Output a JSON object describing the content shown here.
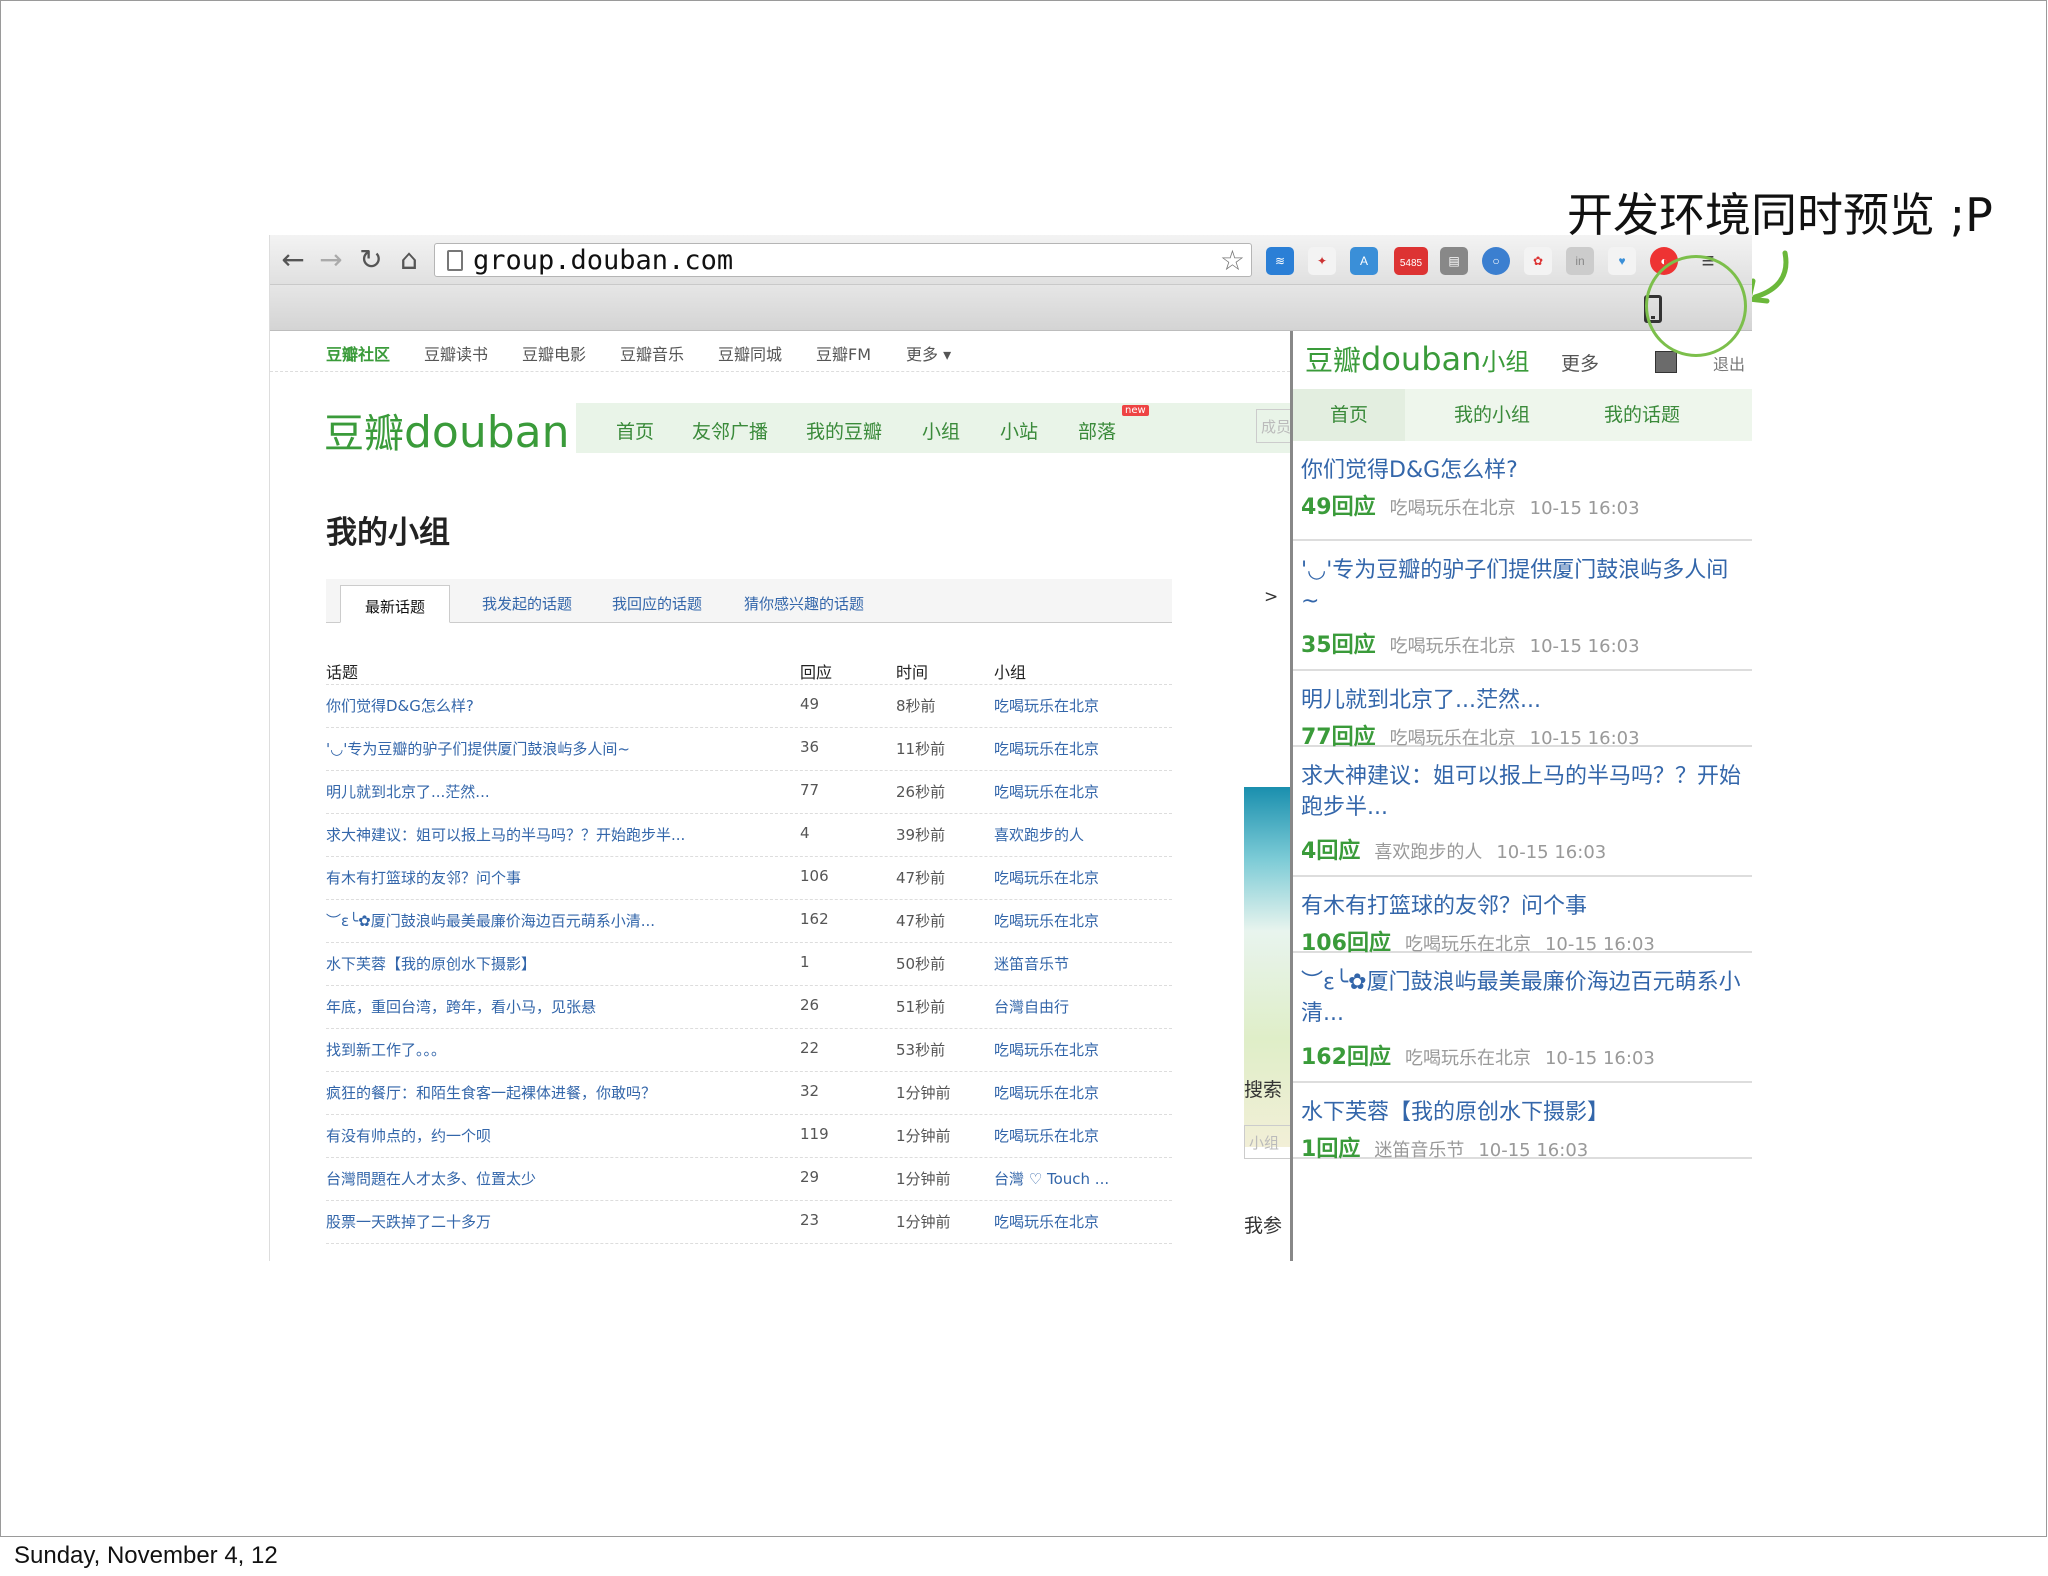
{
  "caption": "开发环境同时预览 ;P",
  "footer": "Sunday, November 4, 12",
  "browser": {
    "url": "group.douban.com",
    "ext_badge": "5485"
  },
  "page": {
    "topnav": [
      "豆瓣社区",
      "豆瓣读书",
      "豆瓣电影",
      "豆瓣音乐",
      "豆瓣同城",
      "豆瓣FM",
      "更多 ▾"
    ],
    "logo_cn": "豆瓣",
    "logo_en": "douban",
    "mainnav": [
      "首页",
      "友邻广播",
      "我的豆瓣",
      "小组",
      "小站",
      "部落"
    ],
    "new_badge": "new",
    "search_placeholder": "成员",
    "heading": "我的小组",
    "tabs": [
      "最新话题",
      "我发起的话题",
      "我回应的话题",
      "猜你感兴趣的话题"
    ],
    "columns": [
      "话题",
      "回应",
      "时间",
      "小组"
    ],
    "rows": [
      {
        "title": "你们觉得D&G怎么样?",
        "reply": "49",
        "time": "8秒前",
        "group": "吃喝玩乐在北京"
      },
      {
        "title": "'◡'专为豆瓣的驴子们提供厦门鼓浪屿多人间~",
        "reply": "36",
        "time": "11秒前",
        "group": "吃喝玩乐在北京"
      },
      {
        "title": "明儿就到北京了...茫然...",
        "reply": "77",
        "time": "26秒前",
        "group": "吃喝玩乐在北京"
      },
      {
        "title": "求大神建议：姐可以报上马的半马吗？？开始跑步半...",
        "reply": "4",
        "time": "39秒前",
        "group": "喜欢跑步的人"
      },
      {
        "title": "有木有打篮球的友邻？问个事",
        "reply": "106",
        "time": "47秒前",
        "group": "吃喝玩乐在北京"
      },
      {
        "title": "︶ε╰✿厦门鼓浪屿最美最廉价海边百元萌系小清...",
        "reply": "162",
        "time": "47秒前",
        "group": "吃喝玩乐在北京"
      },
      {
        "title": "水下芙蓉【我的原创水下摄影】",
        "reply": "1",
        "time": "50秒前",
        "group": "迷笛音乐节"
      },
      {
        "title": "年底，重回台湾，跨年，看小马，见张悬",
        "reply": "26",
        "time": "51秒前",
        "group": "台灣自由行"
      },
      {
        "title": "找到新工作了。。。",
        "reply": "22",
        "time": "53秒前",
        "group": "吃喝玩乐在北京"
      },
      {
        "title": "疯狂的餐厅：和陌生食客一起裸体进餐，你敢吗？",
        "reply": "32",
        "time": "1分钟前",
        "group": "吃喝玩乐在北京"
      },
      {
        "title": "有没有帅点的，约一个呗",
        "reply": "119",
        "time": "1分钟前",
        "group": "吃喝玩乐在北京"
      },
      {
        "title": "台灣問題在人才太多、位置太少",
        "reply": "29",
        "time": "1分钟前",
        "group": "台灣 ♡ Touch ..."
      },
      {
        "title": "股票一天跌掉了二十多万",
        "reply": "23",
        "time": "1分钟前",
        "group": "吃喝玩乐在北京"
      }
    ],
    "side_fragments": {
      "arrow": "> ",
      "search": "搜索",
      "input": "小组",
      "joined": "我参"
    }
  },
  "mobile": {
    "logo_cn": "豆瓣",
    "logo_en": "douban",
    "logo_suffix": "小组",
    "more": "更多",
    "logout": "退出",
    "tabs": [
      "首页",
      "我的小组",
      "我的话题"
    ],
    "items": [
      {
        "title": "你们觉得D&G怎么样?",
        "count": "49",
        "unit": "回应",
        "group": "吃喝玩乐在北京",
        "time": "10-15 16:03"
      },
      {
        "title": "'◡'专为豆瓣的驴子们提供厦门鼓浪屿多人间~",
        "count": "35",
        "unit": "回应",
        "group": "吃喝玩乐在北京",
        "time": "10-15 16:03"
      },
      {
        "title": "明儿就到北京了...茫然...",
        "count": "77",
        "unit": "回应",
        "group": "吃喝玩乐在北京",
        "time": "10-15 16:03"
      },
      {
        "title": "求大神建议：姐可以报上马的半马吗？？开始跑步半...",
        "count": "4",
        "unit": "回应",
        "group": "喜欢跑步的人",
        "time": "10-15 16:03"
      },
      {
        "title": "有木有打篮球的友邻？问个事",
        "count": "106",
        "unit": "回应",
        "group": "吃喝玩乐在北京",
        "time": "10-15 16:03"
      },
      {
        "title": "︶ε╰✿厦门鼓浪屿最美最廉价海边百元萌系小清...",
        "count": "162",
        "unit": "回应",
        "group": "吃喝玩乐在北京",
        "time": "10-15 16:03"
      },
      {
        "title": "水下芙蓉【我的原创水下摄影】",
        "count": "1",
        "unit": "回应",
        "group": "迷笛音乐节",
        "time": "10-15 16:03"
      }
    ]
  }
}
